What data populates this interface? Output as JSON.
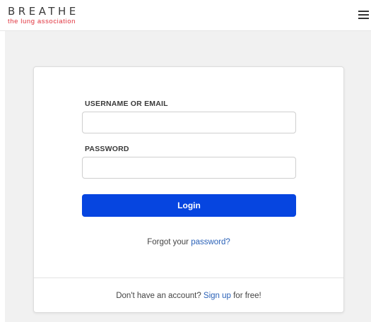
{
  "header": {
    "logo_main": "BREATHE",
    "logo_sub": "the lung association",
    "menu_icon": "hamburger-menu-icon"
  },
  "login": {
    "username_label": "USERNAME OR EMAIL",
    "username_value": "",
    "username_placeholder": "",
    "password_label": "PASSWORD",
    "password_value": "",
    "password_placeholder": "",
    "login_button": "Login",
    "forgot_prefix": "Forgot your ",
    "forgot_link": "password?",
    "signup_prefix": "Don't have an account? ",
    "signup_link": "Sign up",
    "signup_suffix": " for free!"
  },
  "colors": {
    "brand_red": "#e0323d",
    "primary_button": "#0645e0",
    "link": "#2b62b8",
    "page_background": "#f1f1f1"
  }
}
